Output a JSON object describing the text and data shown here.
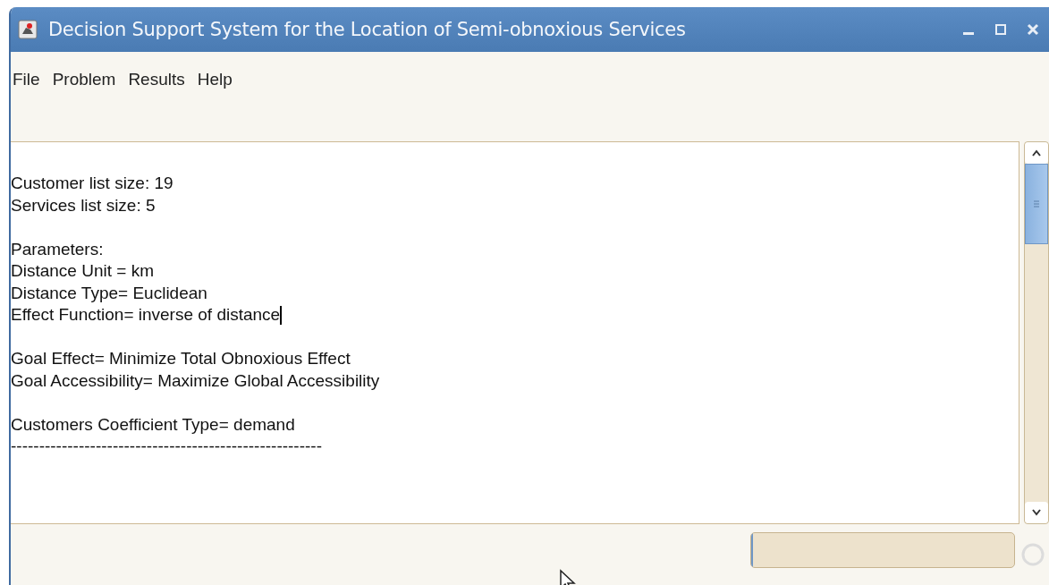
{
  "window": {
    "title": "Decision Support System for the Location of Semi-obnoxious Services"
  },
  "menu": [
    "File",
    "Problem",
    "Results",
    "Help"
  ],
  "output": {
    "paragraphs": [
      [
        {
          "text": "Customer list size: 19",
          "caret": false
        },
        {
          "text": "Services list size: 5",
          "caret": false
        }
      ],
      [
        {
          "text": "Parameters:",
          "caret": false
        },
        {
          "text": "Distance Unit = km",
          "caret": false
        },
        {
          "text": "Distance Type= Euclidean",
          "caret": false
        },
        {
          "text": "Effect Function= inverse of distance",
          "caret": true
        }
      ],
      [
        {
          "text": "Goal Effect= Minimize Total Obnoxious Effect",
          "caret": false
        },
        {
          "text": "Goal Accessibility= Maximize Global Accessibility",
          "caret": false
        }
      ],
      [
        {
          "text": "Customers Coefficient Type= demand",
          "caret": false
        },
        {
          "text": "-------------------------------------------------------",
          "caret": false
        }
      ]
    ]
  },
  "progress": {
    "level": 0
  }
}
